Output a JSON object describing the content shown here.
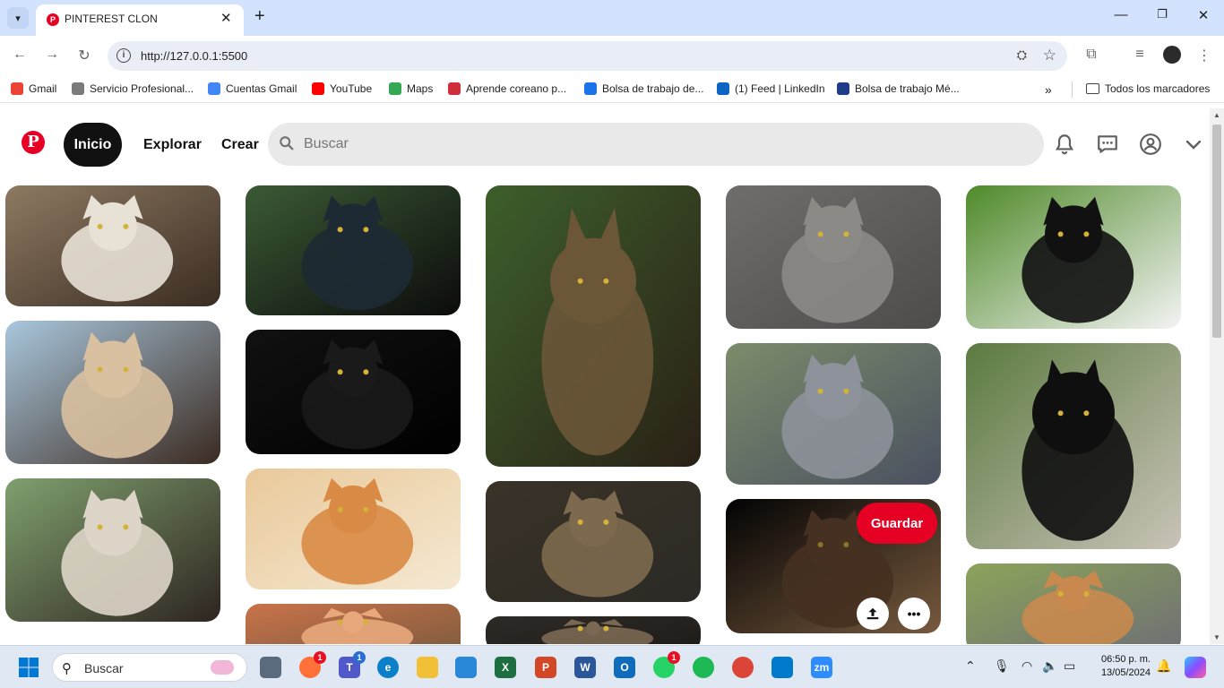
{
  "browser": {
    "tab_title": "PINTEREST CLON",
    "url": "http://127.0.0.1:5500",
    "bookmarks": [
      {
        "label": "Gmail",
        "icon": "gmail-icon",
        "color": "#ea4335"
      },
      {
        "label": "Servicio Profesional...",
        "icon": "site-icon",
        "color": "#7a7a7a"
      },
      {
        "label": "Cuentas Gmail",
        "icon": "google-icon",
        "color": "#4285f4"
      },
      {
        "label": "YouTube",
        "icon": "youtube-icon",
        "color": "#ff0000"
      },
      {
        "label": "Maps",
        "icon": "maps-icon",
        "color": "#34a853"
      },
      {
        "label": "Aprende coreano p...",
        "icon": "flag-icon",
        "color": "#cd2e3a"
      },
      {
        "label": "Bolsa de trabajo de...",
        "icon": "info-icon",
        "color": "#1a73e8"
      },
      {
        "label": "(1) Feed | LinkedIn",
        "icon": "linkedin-icon",
        "color": "#0a66c2"
      },
      {
        "label": "Bolsa de trabajo Mé...",
        "icon": "job-icon",
        "color": "#1f3c88"
      }
    ],
    "all_bookmarks": "Todos los marcadores"
  },
  "pinterest": {
    "nav": {
      "home": "Inicio",
      "explore": "Explorar",
      "create": "Crear"
    },
    "search_placeholder": "Buscar",
    "save_label": "Guardar",
    "more_label": "•••",
    "accent": "#e60023",
    "pins": [
      {
        "desc": "Siamese cat with blue eyes",
        "palette": [
          "#8e7a62",
          "#e8e1d6",
          "#3a2c22"
        ]
      },
      {
        "desc": "Siamese cat sitting on a table",
        "palette": [
          "#a9c7dd",
          "#d8c0a0",
          "#3b2a20"
        ]
      },
      {
        "desc": "Siamese cat lying down",
        "palette": [
          "#7fa06e",
          "#ddd5c8",
          "#2e2420"
        ]
      },
      {
        "desc": "Black cat on a car",
        "palette": [
          "#3b5a35",
          "#1d2a33",
          "#0b0b0b"
        ]
      },
      {
        "desc": "Black cat close-up",
        "palette": [
          "#111111",
          "#1a1a1a",
          "#000000"
        ]
      },
      {
        "desc": "Orange tabby lying",
        "palette": [
          "#e9c99a",
          "#d98b45",
          "#f5e8d2"
        ]
      },
      {
        "desc": "Orange cat",
        "palette": [
          "#c9734a",
          "#e8a87c",
          "#7b5a3e"
        ]
      },
      {
        "desc": "Tabby cat sitting on grass",
        "palette": [
          "#3d5f2b",
          "#6b5638",
          "#2a2016"
        ]
      },
      {
        "desc": "Tabby cat crouching",
        "palette": [
          "#3a3227",
          "#7d6a4e",
          "#2b2a25"
        ]
      },
      {
        "desc": "Tabby cat",
        "palette": [
          "#2e2b27",
          "#7a6852",
          "#1d1a17"
        ]
      },
      {
        "desc": "Gray cat on wooden deck",
        "palette": [
          "#6f6e6c",
          "#8b8a86",
          "#4d4c4a"
        ]
      },
      {
        "desc": "Gray cat on grass",
        "palette": [
          "#7b8c6a",
          "#8e929a",
          "#4a5060"
        ]
      },
      {
        "desc": "Persian cat on black",
        "palette": [
          "#050505",
          "#6a4a33",
          "#b88a60"
        ]
      },
      {
        "desc": "Black and white cat on grass",
        "palette": [
          "#4f8a2a",
          "#111111",
          "#f3f3f3"
        ]
      },
      {
        "desc": "Tuxedo cat sitting on path",
        "palette": [
          "#5b7a40",
          "#0f0f0f",
          "#c9c3b8"
        ]
      },
      {
        "desc": "Kittens",
        "palette": [
          "#8ca35a",
          "#c9894e",
          "#6d6f75"
        ]
      }
    ]
  },
  "taskbar": {
    "search_placeholder": "Buscar",
    "time": "06:50 p. m.",
    "date": "13/05/2024",
    "apps": [
      {
        "name": "task-view",
        "label": "",
        "color": "#5a6b7d"
      },
      {
        "name": "firefox",
        "label": "",
        "color": "#ff7139",
        "badge": "1"
      },
      {
        "name": "teams",
        "label": "T",
        "color": "#5059c9",
        "badge": "1"
      },
      {
        "name": "edge",
        "label": "e",
        "color": "#0c7fc9"
      },
      {
        "name": "file-explorer",
        "label": "",
        "color": "#f2c037"
      },
      {
        "name": "ms-store",
        "label": "",
        "color": "#2b88d8"
      },
      {
        "name": "excel",
        "label": "X",
        "color": "#1d6f42"
      },
      {
        "name": "powerpoint",
        "label": "P",
        "color": "#d24726"
      },
      {
        "name": "word",
        "label": "W",
        "color": "#2b579a"
      },
      {
        "name": "outlook",
        "label": "O",
        "color": "#0f6cbd"
      },
      {
        "name": "whatsapp",
        "label": "",
        "color": "#25d366",
        "badge": "1"
      },
      {
        "name": "spotify",
        "label": "",
        "color": "#1db954"
      },
      {
        "name": "chrome",
        "label": "",
        "color": "#db4437"
      },
      {
        "name": "vscode",
        "label": "",
        "color": "#007acc"
      },
      {
        "name": "zoom",
        "label": "zm",
        "color": "#2d8cff"
      }
    ]
  }
}
